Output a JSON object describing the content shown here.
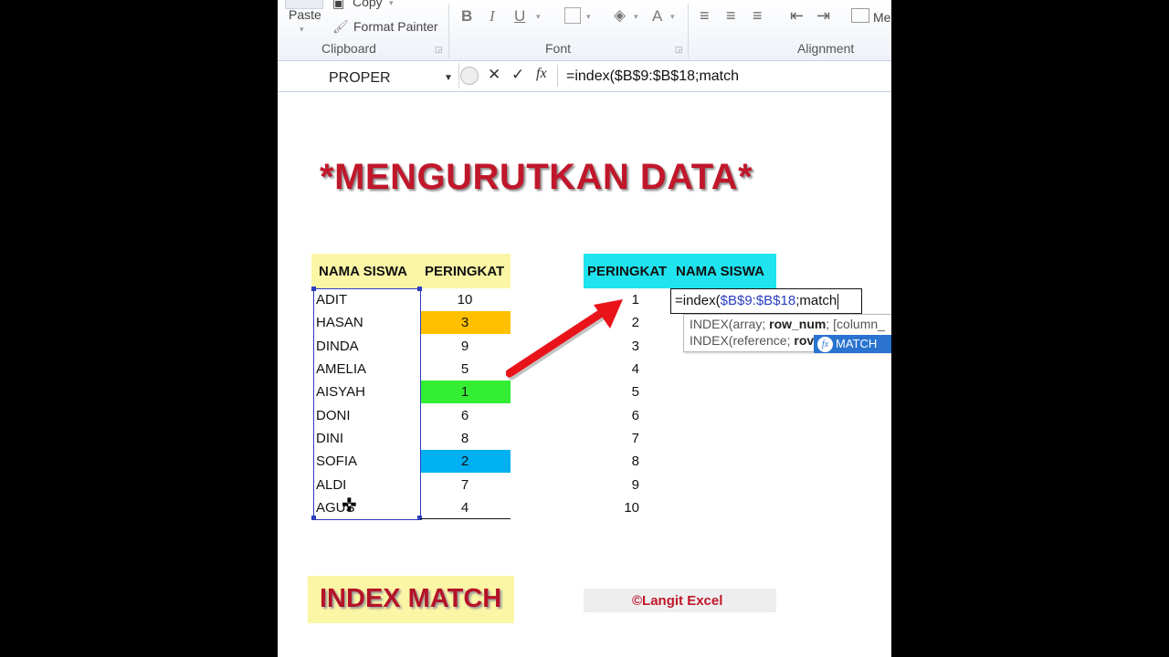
{
  "ribbon": {
    "paste_label": "Paste",
    "copy_label": "Copy",
    "format_painter_label": "Format Painter",
    "clipboard_label": "Clipboard",
    "font_label": "Font",
    "alignment_label": "Alignment",
    "merge_label": "Me"
  },
  "formula_bar": {
    "name_box": "PROPER",
    "cancel": "✕",
    "enter": "✓",
    "fx": "fx",
    "formula": "=index($B$9:$B$18;match"
  },
  "sheet": {
    "title": "*MENGURUTKAN DATA*",
    "left_table": {
      "headers": [
        "NAMA SISWA",
        "PERINGKAT"
      ],
      "rows": [
        {
          "name": "ADIT",
          "rank": "10"
        },
        {
          "name": "HASAN",
          "rank": "3"
        },
        {
          "name": "DINDA",
          "rank": "9"
        },
        {
          "name": "AMELIA",
          "rank": "5"
        },
        {
          "name": "AISYAH",
          "rank": "1"
        },
        {
          "name": "DONI",
          "rank": "6"
        },
        {
          "name": "DINI",
          "rank": "8"
        },
        {
          "name": "SOFIA",
          "rank": "2"
        },
        {
          "name": "ALDI",
          "rank": "7"
        },
        {
          "name": "AGUS",
          "rank": "4"
        }
      ]
    },
    "right_table": {
      "headers": [
        "PERINGKAT",
        "NAMA SISWA"
      ],
      "ranks": [
        "1",
        "2",
        "3",
        "4",
        "5",
        "6",
        "7",
        "8",
        "9",
        "10"
      ],
      "edit_prefix": "=index(",
      "edit_ref": "$B$9:$B$18",
      "edit_suffix": ";match"
    },
    "tooltip": {
      "line1_prefix": "INDEX(array; ",
      "line1_bold": "row_num",
      "line1_suffix": "; [column_",
      "line2_prefix": "INDEX(reference; ",
      "line2_bold": "rov"
    },
    "autocomplete": "MATCH",
    "footer_label": "INDEX MATCH",
    "credit": "©Langit Excel"
  },
  "colors": {
    "rank_3": "#ffc000",
    "rank_1": "#33ee33",
    "rank_2": "#00b0f0",
    "header_left": "#fbf5a6",
    "header_right": "#1fe3ee",
    "title": "#c0172b",
    "arrow": "#e8141a"
  }
}
